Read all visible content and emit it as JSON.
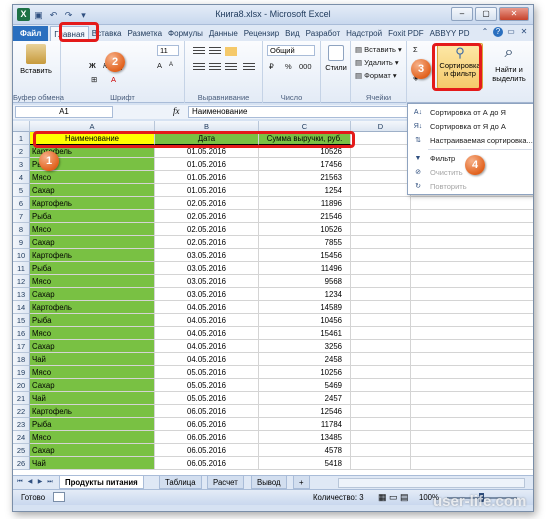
{
  "window": {
    "title": "Книга8.xlsx - Microsoft Excel",
    "app_icon": "X",
    "colors": {
      "file_tab": "#2a6fbf",
      "column_fill": "#79c143",
      "header_yellow": "#ffff00",
      "callout_border": "#e41a1a",
      "badge": "#e2631f"
    }
  },
  "ribbon_tabs": [
    "Файл",
    "Главная",
    "Вставка",
    "Разметка",
    "Формулы",
    "Данные",
    "Рецензир",
    "Вид",
    "Разработ",
    "Надстрой",
    "Foxit PDF",
    "ABBYY PD"
  ],
  "ribbon": {
    "paste_label": "Вставить",
    "clipboard_label": "Буфер обмена",
    "font_size": "11",
    "font_label": "Шрифт",
    "align_label": "Выравнивание",
    "number_format": "Общий",
    "number_label": "Число",
    "styles_label": "Стили",
    "insert_label": "Вставить",
    "delete_label": "Удалить",
    "format_label": "Формат",
    "cells_label": "Ячейки",
    "sort_filter_line1": "Сортировка",
    "sort_filter_line2": "и фильтр",
    "find_line1": "Найти и",
    "find_line2": "выделить",
    "percent": "%",
    "sigma": "Σ"
  },
  "formula_bar": {
    "name_box": "A1",
    "fx": "fx",
    "value": "Наименование"
  },
  "columns": [
    "A",
    "B",
    "C",
    "D"
  ],
  "headers": {
    "name": "Наименование",
    "date": "Дата",
    "revenue": "Сумма выручки, руб."
  },
  "rows": [
    {
      "n": "1",
      "a": "Наименование",
      "b": "Дата",
      "c": "Сумма выручки, руб."
    },
    {
      "n": "2",
      "a": "Картофель",
      "b": "01.05.2016",
      "c": "10526"
    },
    {
      "n": "3",
      "a": "Рыба",
      "b": "01.05.2016",
      "c": "17456"
    },
    {
      "n": "4",
      "a": "Мясо",
      "b": "01.05.2016",
      "c": "21563"
    },
    {
      "n": "5",
      "a": "Сахар",
      "b": "01.05.2016",
      "c": "1254"
    },
    {
      "n": "6",
      "a": "Картофель",
      "b": "02.05.2016",
      "c": "11896"
    },
    {
      "n": "7",
      "a": "Рыба",
      "b": "02.05.2016",
      "c": "21546"
    },
    {
      "n": "8",
      "a": "Мясо",
      "b": "02.05.2016",
      "c": "10526"
    },
    {
      "n": "9",
      "a": "Сахар",
      "b": "02.05.2016",
      "c": "7855"
    },
    {
      "n": "10",
      "a": "Картофель",
      "b": "03.05.2016",
      "c": "15456"
    },
    {
      "n": "11",
      "a": "Рыба",
      "b": "03.05.2016",
      "c": "11496"
    },
    {
      "n": "12",
      "a": "Мясо",
      "b": "03.05.2016",
      "c": "9568"
    },
    {
      "n": "13",
      "a": "Сахар",
      "b": "03.05.2016",
      "c": "1234"
    },
    {
      "n": "14",
      "a": "Картофель",
      "b": "04.05.2016",
      "c": "14589"
    },
    {
      "n": "15",
      "a": "Рыба",
      "b": "04.05.2016",
      "c": "10456"
    },
    {
      "n": "16",
      "a": "Мясо",
      "b": "04.05.2016",
      "c": "15461"
    },
    {
      "n": "17",
      "a": "Сахар",
      "b": "04.05.2016",
      "c": "3256"
    },
    {
      "n": "18",
      "a": "Чай",
      "b": "04.05.2016",
      "c": "2458"
    },
    {
      "n": "19",
      "a": "Мясо",
      "b": "05.05.2016",
      "c": "10256"
    },
    {
      "n": "20",
      "a": "Сахар",
      "b": "05.05.2016",
      "c": "5469"
    },
    {
      "n": "21",
      "a": "Чай",
      "b": "05.05.2016",
      "c": "2457"
    },
    {
      "n": "22",
      "a": "Картофель",
      "b": "06.05.2016",
      "c": "12546"
    },
    {
      "n": "23",
      "a": "Рыба",
      "b": "06.05.2016",
      "c": "11784"
    },
    {
      "n": "24",
      "a": "Мясо",
      "b": "06.05.2016",
      "c": "13485"
    },
    {
      "n": "25",
      "a": "Сахар",
      "b": "06.05.2016",
      "c": "4578"
    },
    {
      "n": "26",
      "a": "Чай",
      "b": "06.05.2016",
      "c": "5418"
    }
  ],
  "dropdown": {
    "sort_az": "Сортировка от А до Я",
    "sort_za": "Сортировка от Я до А",
    "custom_sort": "Настраиваемая сортировка...",
    "filter": "Фильтр",
    "clear": "Очистить",
    "reapply": "Повторить"
  },
  "sheet_tabs": [
    "Продукты питания",
    "Таблица",
    "Расчет",
    "Вывод"
  ],
  "status": {
    "ready": "Готово",
    "count": "Количество: 3",
    "zoom": "100%"
  },
  "badges": [
    "1",
    "2",
    "3",
    "4"
  ],
  "watermark": "user-life.com"
}
